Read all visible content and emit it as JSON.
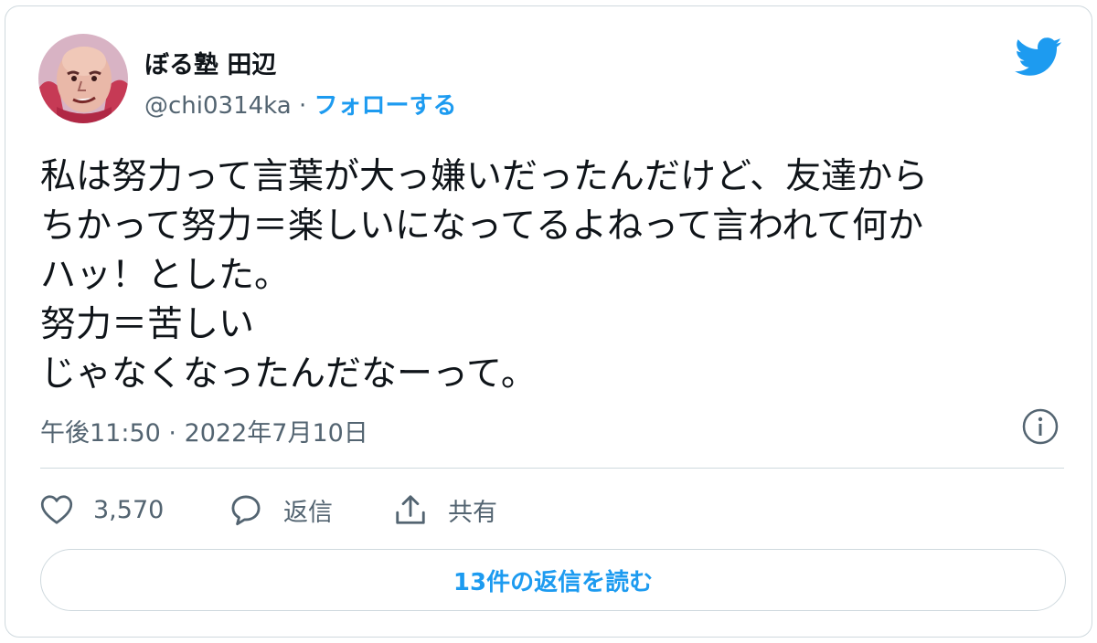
{
  "author": {
    "display_name": "ぼる塾 田辺",
    "handle": "@chi0314ka",
    "separator": " · ",
    "follow_label": "フォローする"
  },
  "tweet": {
    "lines": [
      "私は努力って言葉が大っ嫌いだったんだけど、友達から",
      "ちかって努力＝楽しいになってるよねって言われて何か",
      "ハッ！とした。",
      "努力＝苦しい",
      "じゃなくなったんだなーって。"
    ],
    "time": "午後11:50",
    "time_separator": " · ",
    "date": "2022年7月10日"
  },
  "actions": {
    "likes_count": "3,570",
    "reply_label": "返信",
    "share_label": "共有"
  },
  "read_replies_label": "13件の返信を読む",
  "icons": {
    "brand": "twitter-bird-icon",
    "info": "info-icon",
    "like": "heart-icon",
    "reply": "speech-bubble-icon",
    "share": "share-upload-icon"
  },
  "colors": {
    "accent": "#1d9bf0",
    "text_primary": "#0f1419",
    "text_secondary": "#536471",
    "border": "#cfd9de"
  }
}
